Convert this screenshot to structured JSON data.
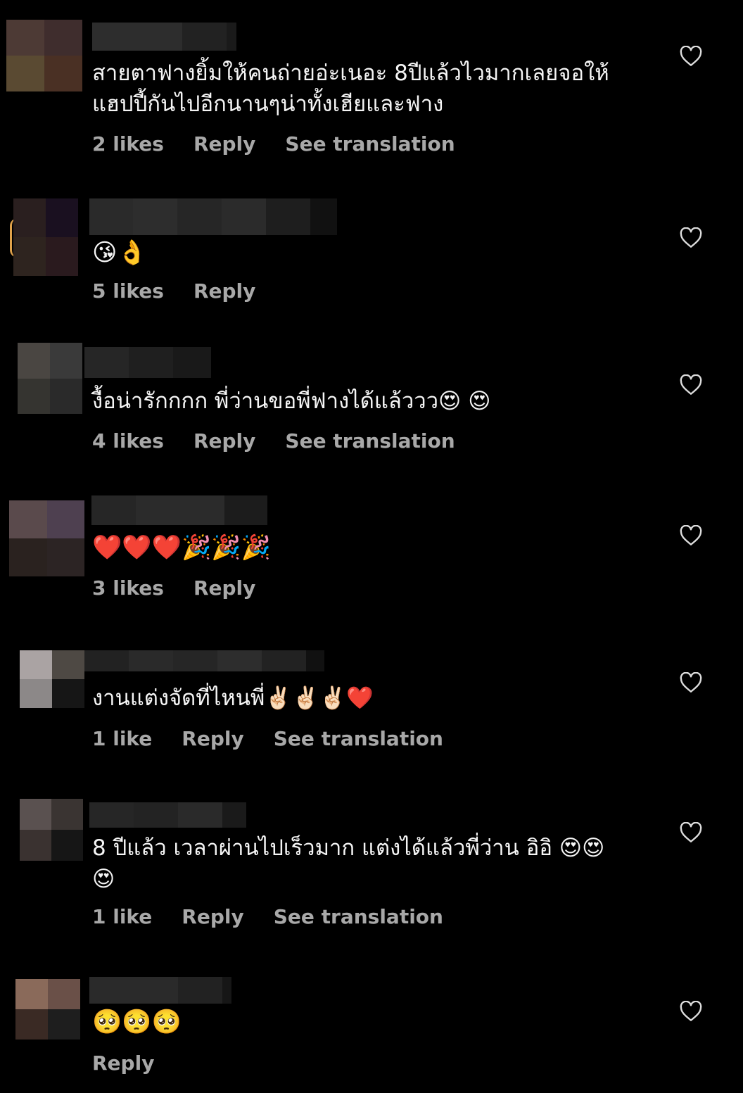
{
  "colors": {
    "background": "#000000",
    "text": "#f5f5f5",
    "meta": "#a8a8a8"
  },
  "icons": {
    "like": "heart-outline-icon"
  },
  "comments": [
    {
      "text": "สายตาฟางยิ้มให้คนถ่ายอ่ะเนอะ 8ปีแล้วไวมากเลยจอให้แฮปปี้กันไปอีกนานๆน่าทั้งเฮียและฟาง",
      "likes": "2 likes",
      "reply": "Reply",
      "translate": "See translation"
    },
    {
      "text": "😘👌",
      "likes": "5 likes",
      "reply": "Reply",
      "translate": ""
    },
    {
      "text": "งื้อน่ารักกกก พี่ว่านขอพี่ฟางได้แล้ววว😍 😍",
      "likes": "4 likes",
      "reply": "Reply",
      "translate": "See translation"
    },
    {
      "text": "❤️❤️❤️🎉🎉🎉",
      "likes": "3 likes",
      "reply": "Reply",
      "translate": ""
    },
    {
      "text": "งานแต่งจัดที่ไหนพี่✌🏻✌🏻✌🏻❤️",
      "likes": "1 like",
      "reply": "Reply",
      "translate": "See translation"
    },
    {
      "text": "8 ปีแล้ว เวลาผ่านไปเร็วมาก แต่งได้แล้วพี่ว่าน อิอิ 😍😍😍",
      "likes": "1 like",
      "reply": "Reply",
      "translate": "See translation"
    },
    {
      "text": "🥺🥺🥺",
      "likes": "",
      "reply": "Reply",
      "translate": ""
    }
  ]
}
